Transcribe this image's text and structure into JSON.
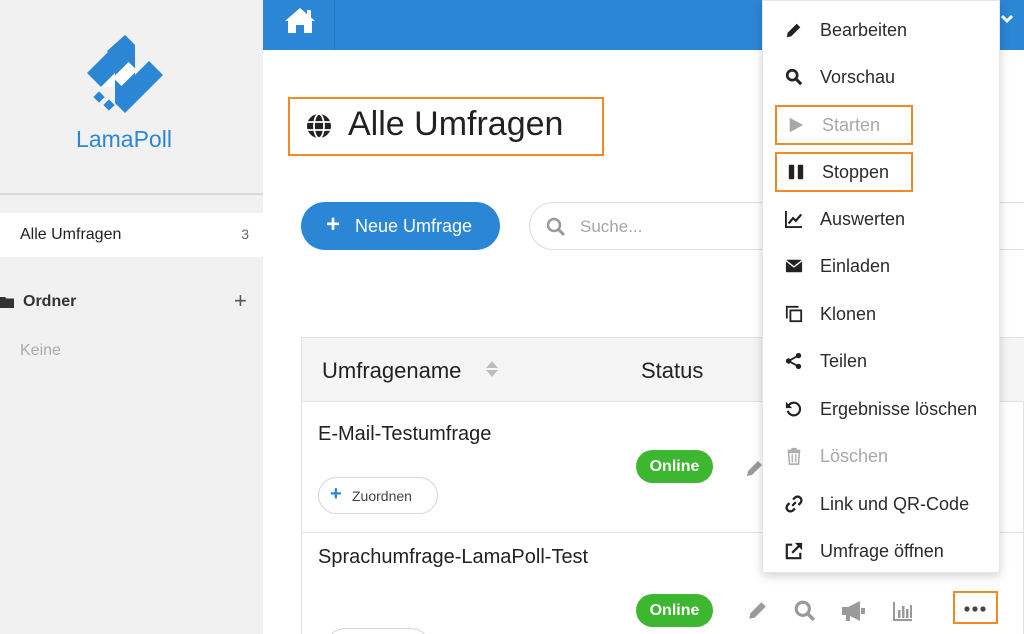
{
  "sidebar": {
    "logo_text": "LamaPoll",
    "nav": [
      {
        "label": "Alle Umfragen",
        "count": "3"
      }
    ],
    "folders": {
      "label": "Ordner",
      "add": "+",
      "empty": "Keine"
    }
  },
  "header": {
    "title": "Alle Umfragen"
  },
  "toolbar": {
    "new_survey": "Neue Umfrage",
    "search_placeholder": "Suche..."
  },
  "table": {
    "columns": [
      "Umfragename",
      "Status"
    ],
    "rows": [
      {
        "name": "E-Mail-Testumfrage",
        "status": "Online",
        "assign": "Zuordnen"
      },
      {
        "name": "Sprachumfrage-LamaPoll-Test",
        "status": "Online"
      }
    ]
  },
  "menu": {
    "items": [
      {
        "label": "Bearbeiten",
        "icon": "pencil-icon"
      },
      {
        "label": "Vorschau",
        "icon": "search-icon"
      },
      {
        "label": "Starten",
        "icon": "play-icon",
        "disabled": true,
        "highlighted": true
      },
      {
        "label": "Stoppen",
        "icon": "pause-icon",
        "highlighted": true
      },
      {
        "label": "Auswerten",
        "icon": "chart-icon"
      },
      {
        "label": "Einladen",
        "icon": "envelope-icon"
      },
      {
        "label": "Klonen",
        "icon": "clone-icon"
      },
      {
        "label": "Teilen",
        "icon": "share-icon"
      },
      {
        "label": "Ergebnisse löschen",
        "icon": "undo-icon"
      },
      {
        "label": "Löschen",
        "icon": "trash-icon",
        "disabled": true
      },
      {
        "label": "Link und QR-Code",
        "icon": "link-icon"
      },
      {
        "label": "Umfrage öffnen",
        "icon": "external-link-icon"
      }
    ]
  },
  "colors": {
    "primary": "#2b86d6",
    "success": "#3cb72f",
    "highlight": "#f08a24",
    "sidebar_bg": "#f1f1f1"
  }
}
